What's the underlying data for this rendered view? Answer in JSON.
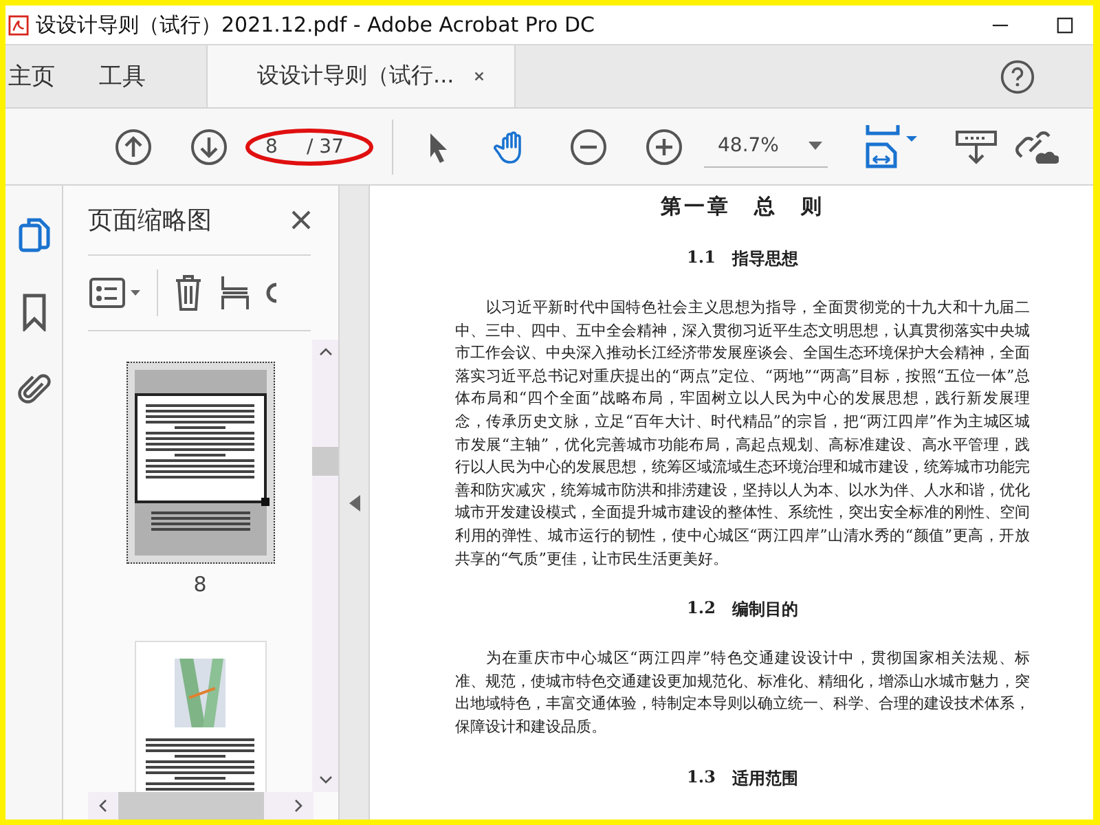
{
  "window": {
    "title": "设设计导则（试行）2021.12.pdf - Adobe Acrobat Pro DC"
  },
  "tabs": [
    {
      "kind": "nav",
      "label": "主页",
      "selected": false
    },
    {
      "kind": "nav",
      "label": "工具",
      "selected": false
    },
    {
      "kind": "document",
      "label": "设设计导则（试行...",
      "selected": true
    }
  ],
  "toolbar": {
    "page_current": "8",
    "page_total": "/ 37",
    "zoom": "48.7%"
  },
  "rail": [
    {
      "kind": "pages",
      "selected": true
    },
    {
      "kind": "bookmarks",
      "selected": false
    },
    {
      "kind": "attachments",
      "selected": false
    }
  ],
  "thumbnail_panel": {
    "title": "页面缩略图",
    "thumbnails": [
      {
        "kind": "text",
        "label": "8",
        "selected": true
      },
      {
        "kind": "map",
        "selected": false
      }
    ]
  },
  "document": {
    "chapter_title": "第一章　总　则",
    "sections": [
      {
        "number": "1.1",
        "title": "指导思想",
        "paragraphs": [
          "以习近平新时代中国特色社会主义思想为指导，全面贯彻党的十九大和十九届二中、三中、四中、五中全会精神，深入贯彻习近平生态文明思想，认真贯彻落实中央城市工作会议、中央深入推动长江经济带发展座谈会、全国生态环境保护大会精神，全面落实习近平总书记对重庆提出的“两点”定位、“两地”“两高”目标，按照“五位一体”总体布局和“四个全面”战略布局，牢固树立以人民为中心的发展思想，践行新发展理念，传承历史文脉，立足“百年大计、时代精品”的宗旨，把“两江四岸”作为主城区城市发展“主轴”，优化完善城市功能布局，高起点规划、高标准建设、高水平管理，践行以人民为中心的发展思想，统筹区域流域生态环境治理和城市建设，统筹城市功能完善和防灾减灾，统筹城市防洪和排涝建设，坚持以人为本、以水为伴、人水和谐，优化城市开发建设模式，全面提升城市建设的整体性、系统性，突出安全标准的刚性、空间利用的弹性、城市运行的韧性，使中心城区“两江四岸”山清水秀的“颜值”更高，开放共享的“气质”更佳，让市民生活更美好。"
        ]
      },
      {
        "number": "1.2",
        "title": "编制目的",
        "paragraphs": [
          "为在重庆市中心城区“两江四岸”特色交通建设设计中，贯彻国家相关法规、标准、规范，使城市特色交通建设更加规范化、标准化、精细化，增添山水城市魅力，突出地域特色，丰富交通体验，特制定本导则以确立统一、科学、合理的建设技术体系，保障设计和建设品质。"
        ]
      },
      {
        "number": "1.3",
        "title": "适用范围"
      }
    ]
  }
}
